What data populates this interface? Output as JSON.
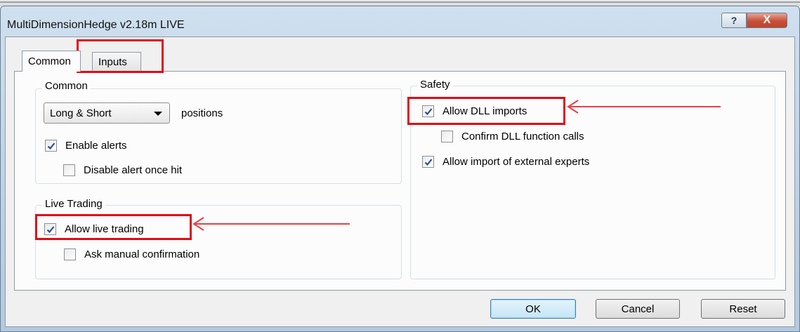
{
  "window": {
    "title": "MultiDimensionHedge v2.18m LIVE",
    "help_glyph": "?",
    "close_glyph": "X"
  },
  "tabs": [
    {
      "label": "Common",
      "selected": true
    },
    {
      "label": "Inputs",
      "selected": false
    }
  ],
  "common_group": {
    "label": "Common",
    "positions_select": {
      "value": "Long & Short"
    },
    "positions_label": "positions",
    "enable_alerts": {
      "label": "Enable alerts",
      "checked": true
    },
    "disable_alert_once_hit": {
      "label": "Disable alert once hit",
      "checked": false
    }
  },
  "live_trading_group": {
    "label": "Live Trading",
    "allow_live_trading": {
      "label": "Allow live trading",
      "checked": true
    },
    "ask_manual_confirmation": {
      "label": "Ask manual confirmation",
      "checked": false
    }
  },
  "safety_group": {
    "label": "Safety",
    "allow_dll_imports": {
      "label": "Allow DLL imports",
      "checked": true
    },
    "confirm_dll_function_calls": {
      "label": "Confirm DLL function calls",
      "checked": false
    },
    "allow_import_external_experts": {
      "label": "Allow import of external experts",
      "checked": true
    }
  },
  "buttons": {
    "ok": "OK",
    "cancel": "Cancel",
    "reset": "Reset"
  },
  "colors": {
    "annotation_red": "#e10b16",
    "check_blue": "#2b4f8c"
  }
}
